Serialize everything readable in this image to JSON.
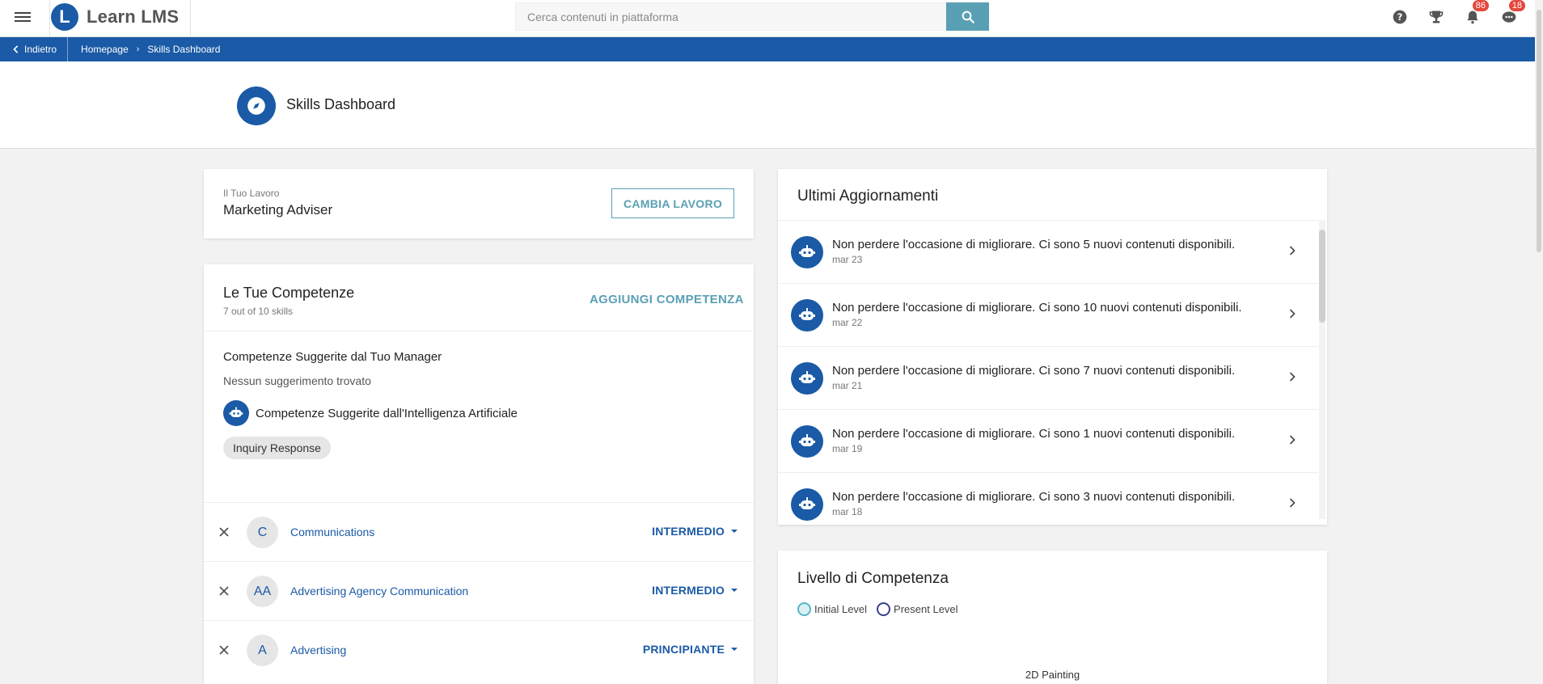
{
  "app": {
    "name": "Learn LMS",
    "logo_letter": "L"
  },
  "search": {
    "placeholder": "Cerca contenuti in piattaforma"
  },
  "top_icons": [
    {
      "name": "help-icon"
    },
    {
      "name": "trophy-icon"
    },
    {
      "name": "bell-icon",
      "badge": "86"
    },
    {
      "name": "chat-icon",
      "badge": "18"
    }
  ],
  "breadcrumb": {
    "back": "Indietro",
    "items": [
      "Homepage",
      "Skills Dashboard"
    ]
  },
  "page": {
    "title": "Skills Dashboard"
  },
  "job": {
    "label": "Il Tuo Lavoro",
    "value": "Marketing Adviser",
    "change_button": "CAMBIA LAVORO"
  },
  "skills": {
    "title": "Le Tue Competenze",
    "subtitle": "7 out of 10 skills",
    "add_button": "AGGIUNGI COMPETENZA",
    "manager_title": "Competenze Suggerite dal Tuo Manager",
    "manager_empty": "Nessun suggerimento trovato",
    "ai_title": "Competenze Suggerite dall'Intelligenza Artificiale",
    "ai_chip": "Inquiry Response",
    "list": [
      {
        "initials": "C",
        "name": "Communications",
        "level": "INTERMEDIO"
      },
      {
        "initials": "AA",
        "name": "Advertising Agency Communication",
        "level": "INTERMEDIO"
      },
      {
        "initials": "A",
        "name": "Advertising",
        "level": "PRINCIPIANTE"
      }
    ]
  },
  "updates": {
    "title": "Ultimi Aggiornamenti",
    "items": [
      {
        "text": "Non perdere l'occasione di migliorare. Ci sono 5 nuovi contenuti disponibili.",
        "date": "mar 23"
      },
      {
        "text": "Non perdere l'occasione di migliorare. Ci sono 10 nuovi contenuti disponibili.",
        "date": "mar 22"
      },
      {
        "text": "Non perdere l'occasione di migliorare. Ci sono 7 nuovi contenuti disponibili.",
        "date": "mar 21"
      },
      {
        "text": "Non perdere l'occasione di migliorare. Ci sono 1 nuovi contenuti disponibili.",
        "date": "mar 19"
      },
      {
        "text": "Non perdere l'occasione di migliorare. Ci sono 3 nuovi contenuti disponibili.",
        "date": "mar 18"
      }
    ]
  },
  "level": {
    "title": "Livello di Competenza",
    "legend": [
      {
        "label": "Initial Level",
        "color": "#5ab4c8"
      },
      {
        "label": "Present Level",
        "color": "#3a3f8f"
      }
    ],
    "axis_label": "2D Painting"
  },
  "colors": {
    "primary": "#1a5aa6",
    "accent": "#5aa0b4",
    "badge": "#e5483c"
  }
}
